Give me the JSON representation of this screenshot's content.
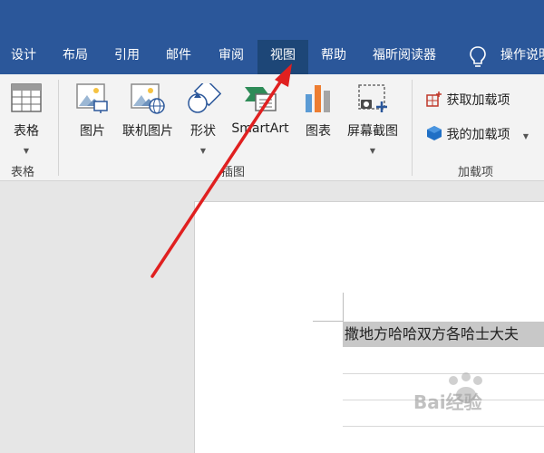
{
  "tabs": [
    {
      "label": "设计",
      "active": false
    },
    {
      "label": "布局",
      "active": false
    },
    {
      "label": "引用",
      "active": false
    },
    {
      "label": "邮件",
      "active": false
    },
    {
      "label": "审阅",
      "active": false
    },
    {
      "label": "视图",
      "active": true
    },
    {
      "label": "帮助",
      "active": false
    },
    {
      "label": "福昕阅读器",
      "active": false
    }
  ],
  "tell_me": {
    "label": "操作说明",
    "icon": "lightbulb-icon"
  },
  "ribbon": {
    "groups": {
      "tables": {
        "label": "表格",
        "buttons": {
          "table": {
            "label": "表格",
            "icon": "table-icon"
          }
        }
      },
      "illustrations": {
        "label": "插图",
        "buttons": {
          "picture": {
            "label": "图片",
            "icon": "picture-icon"
          },
          "online_picture": {
            "label": "联机图片",
            "icon": "online-picture-icon"
          },
          "shapes": {
            "label": "形状",
            "icon": "shapes-icon"
          },
          "smartart": {
            "label": "SmartArt",
            "icon": "smartart-icon"
          },
          "chart": {
            "label": "图表",
            "icon": "chart-icon"
          },
          "screenshot": {
            "label": "屏幕截图",
            "icon": "screenshot-icon"
          }
        }
      },
      "addins": {
        "label": "加载项",
        "buttons": {
          "get_addins": {
            "label": "获取加载项",
            "icon": "store-icon"
          },
          "my_addins": {
            "label": "我的加载项",
            "icon": "addin-cube-icon"
          }
        }
      }
    }
  },
  "document": {
    "selected_text": "撒地方哈哈双方各哈士大夫"
  },
  "watermark": {
    "text": "Bai经验"
  },
  "colors": {
    "brand": "#2b579a",
    "active_tab": "#1d4677",
    "annotation_arrow": "#e02020",
    "selection": "#c8c8c8"
  }
}
